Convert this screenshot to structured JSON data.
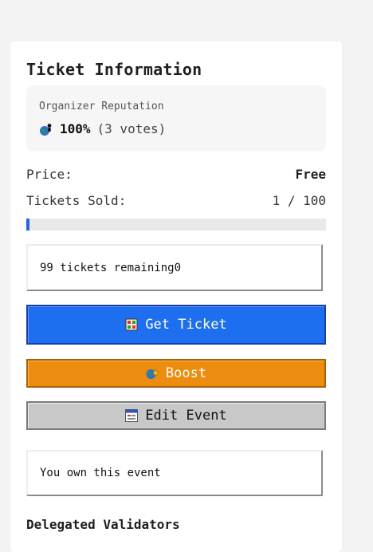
{
  "title": "Ticket Information",
  "reputation": {
    "label": "Organizer Reputation",
    "icon": "globe-person-icon",
    "percent": "100%",
    "votes": "(3 votes)"
  },
  "price": {
    "label": "Price:",
    "value": "Free"
  },
  "tickets_sold": {
    "label": "Tickets Sold:",
    "value": "1 / 100",
    "progress": 0.01
  },
  "remaining_text": "99 tickets remaining0",
  "buttons": {
    "get_ticket": {
      "label": "Get Ticket",
      "icon": "ticket-icon",
      "color": "#1e6ff0"
    },
    "boost": {
      "label": "Boost",
      "icon": "globe-star-icon",
      "color": "#ec8d0f"
    },
    "edit_event": {
      "label": "Edit Event",
      "icon": "window-icon",
      "color": "#c8c8c8"
    }
  },
  "owner_text": "You own this event",
  "validators_heading": "Delegated Validators"
}
